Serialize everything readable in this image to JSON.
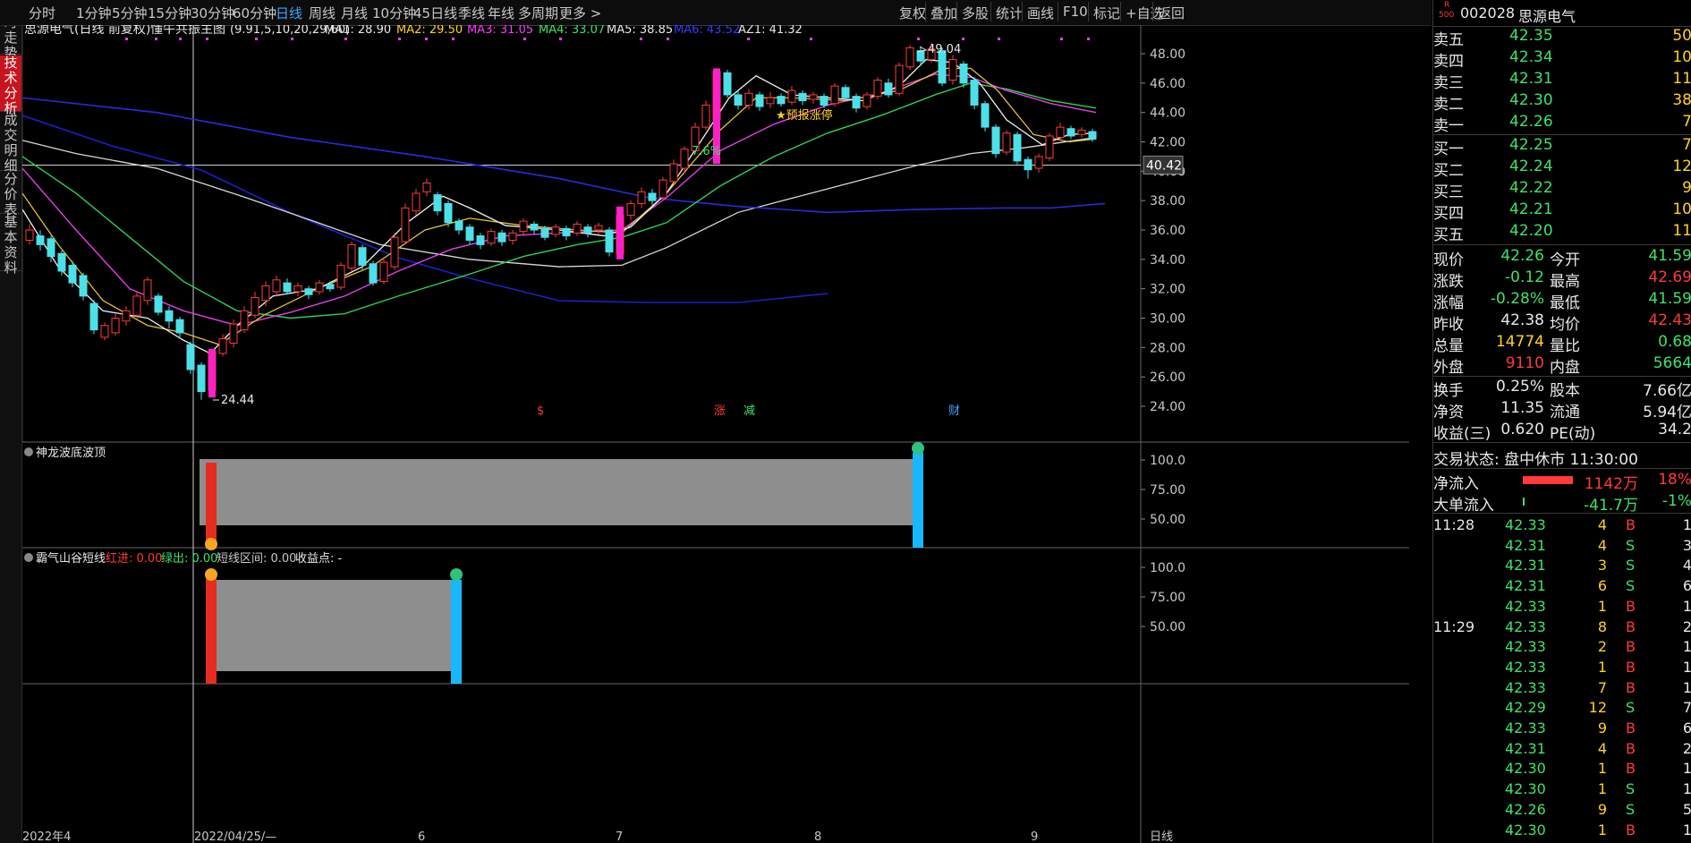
{
  "toolbar": {
    "periods": [
      "分时",
      "1分钟",
      "5分钟",
      "15分钟",
      "30分钟",
      "60分钟",
      "日线",
      "周线",
      "月线",
      "10分钟",
      "45日线",
      "季线",
      "年线",
      "多周期",
      "更多 >"
    ],
    "active_period": "日线",
    "actions": [
      "复权",
      "叠加",
      "多股",
      "统计",
      "画线",
      "F10",
      "标记",
      "+自选",
      "返回"
    ]
  },
  "left_tabs": [
    "分时走势",
    "技术分析",
    "成交明细",
    "分价表",
    "基本资料"
  ],
  "main_chart": {
    "legend_stock": "思源电气(日线 前复权)",
    "indicator_name": "懂牛共振主图",
    "params": "(9.91,5,10,20,29,60)",
    "ma": [
      {
        "label": "MA1: 28.90",
        "color": "#e8e8e8"
      },
      {
        "label": "MA2: 29.50",
        "color": "#ffd21f"
      },
      {
        "label": "MA3: 31.05",
        "color": "#ff3bff"
      },
      {
        "label": "MA4: 33.07",
        "color": "#3ee36a"
      },
      {
        "label": "MA5: 38.85",
        "color": "#e8e8e8"
      },
      {
        "label": "MA6: 43.52",
        "color": "#3a3aff"
      },
      {
        "label": "AZ1: 41.32",
        "color": "#e8e8e8"
      }
    ],
    "price_ticks": [
      "48.00",
      "46.00",
      "44.00",
      "42.00",
      "40.00",
      "38.00",
      "36.00",
      "34.00",
      "32.00",
      "30.00",
      "28.00",
      "26.00",
      "24.00"
    ],
    "crosshair_price": "40.42",
    "high_label": "49.04",
    "low_label": "24.44",
    "pct_label": "7.6%",
    "signal_label": "★预报涨停",
    "event_markers": [
      {
        "text": "$",
        "color": "#ff3b3b"
      },
      {
        "text": "涨",
        "color": "#ff3b3b"
      },
      {
        "text": "减",
        "color": "#3ee36a"
      },
      {
        "text": "财",
        "color": "#3ea6ff"
      }
    ]
  },
  "panel1": {
    "title": "神龙波底波顶",
    "ticks": [
      "100.0",
      "75.00",
      "50.00"
    ]
  },
  "panel2": {
    "title": "霸气山谷短线",
    "red_in": "红进: 0.00",
    "green_out": "绿出: 0.00",
    "range": "短线区间: 0.00",
    "profit": "收益点: -",
    "ticks": [
      "100.0",
      "75.00",
      "50.00"
    ]
  },
  "x_axis": {
    "labels": [
      "2022年4",
      "2022/04/25/—",
      "6",
      "7",
      "8",
      "9"
    ],
    "right_label": "日线"
  },
  "quote": {
    "badge_top": "R",
    "badge_bottom": "500",
    "code": "002028",
    "name": "思源电气",
    "asks": [
      {
        "label": "卖五",
        "price": "42.35",
        "vol": "50"
      },
      {
        "label": "卖四",
        "price": "42.34",
        "vol": "10"
      },
      {
        "label": "卖三",
        "price": "42.31",
        "vol": "11"
      },
      {
        "label": "卖二",
        "price": "42.30",
        "vol": "38"
      },
      {
        "label": "卖一",
        "price": "42.26",
        "vol": "7"
      }
    ],
    "bids": [
      {
        "label": "买一",
        "price": "42.25",
        "vol": "7"
      },
      {
        "label": "买二",
        "price": "42.24",
        "vol": "12"
      },
      {
        "label": "买三",
        "price": "42.22",
        "vol": "9"
      },
      {
        "label": "买四",
        "price": "42.21",
        "vol": "10"
      },
      {
        "label": "买五",
        "price": "42.20",
        "vol": "11"
      }
    ],
    "stats": [
      {
        "l1": "现价",
        "v1": "42.26",
        "c1": "green",
        "l2": "今开",
        "v2": "41.59",
        "c2": "green"
      },
      {
        "l1": "涨跌",
        "v1": "-0.12",
        "c1": "green",
        "l2": "最高",
        "v2": "42.69",
        "c2": "red"
      },
      {
        "l1": "涨幅",
        "v1": "-0.28%",
        "c1": "green",
        "l2": "最低",
        "v2": "41.59",
        "c2": "green"
      },
      {
        "l1": "昨收",
        "v1": "42.38",
        "c1": "white",
        "l2": "均价",
        "v2": "42.43",
        "c2": "red"
      },
      {
        "l1": "总量",
        "v1": "14774",
        "c1": "yellow",
        "l2": "量比",
        "v2": "0.68",
        "c2": "green"
      },
      {
        "l1": "外盘",
        "v1": "9110",
        "c1": "red",
        "l2": "内盘",
        "v2": "5664",
        "c2": "green"
      }
    ],
    "stats2": [
      {
        "l1": "换手",
        "v1": "0.25%",
        "l2": "股本",
        "v2": "7.66亿"
      },
      {
        "l1": "净资",
        "v1": "11.35",
        "l2": "流通",
        "v2": "5.94亿"
      },
      {
        "l1": "收益(三)",
        "v1": "0.620",
        "l2": "PE(动)",
        "v2": "34.2"
      }
    ],
    "trade_status": "交易状态: 盘中休市 11:30:00",
    "net_inflow": {
      "label": "净流入",
      "value": "1142万",
      "pct": "18%",
      "bar_fill": 0.8
    },
    "big_inflow": {
      "label": "大单流入",
      "value": "-41.7万",
      "pct": "-1%"
    },
    "ticks": [
      {
        "time": "11:28",
        "price": "42.33",
        "vol": "4",
        "side": "B",
        "extra": "1"
      },
      {
        "time": "",
        "price": "42.31",
        "vol": "4",
        "side": "S",
        "extra": "3"
      },
      {
        "time": "",
        "price": "42.31",
        "vol": "3",
        "side": "S",
        "extra": "4"
      },
      {
        "time": "",
        "price": "42.31",
        "vol": "6",
        "side": "S",
        "extra": "6"
      },
      {
        "time": "",
        "price": "42.33",
        "vol": "1",
        "side": "B",
        "extra": "1"
      },
      {
        "time": "11:29",
        "price": "42.33",
        "vol": "8",
        "side": "B",
        "extra": "2"
      },
      {
        "time": "",
        "price": "42.33",
        "vol": "2",
        "side": "B",
        "extra": "1"
      },
      {
        "time": "",
        "price": "42.33",
        "vol": "1",
        "side": "B",
        "extra": "1"
      },
      {
        "time": "",
        "price": "42.33",
        "vol": "7",
        "side": "B",
        "extra": "1"
      },
      {
        "time": "",
        "price": "42.29",
        "vol": "12",
        "side": "S",
        "extra": "7"
      },
      {
        "time": "",
        "price": "42.33",
        "vol": "9",
        "side": "B",
        "extra": "6"
      },
      {
        "time": "",
        "price": "42.31",
        "vol": "4",
        "side": "B",
        "extra": "2"
      },
      {
        "time": "",
        "price": "42.30",
        "vol": "1",
        "side": "B",
        "extra": "1"
      },
      {
        "time": "",
        "price": "42.30",
        "vol": "1",
        "side": "S",
        "extra": "1"
      },
      {
        "time": "",
        "price": "42.26",
        "vol": "9",
        "side": "S",
        "extra": "5"
      },
      {
        "time": "",
        "price": "42.30",
        "vol": "1",
        "side": "B",
        "extra": "1"
      }
    ]
  }
}
